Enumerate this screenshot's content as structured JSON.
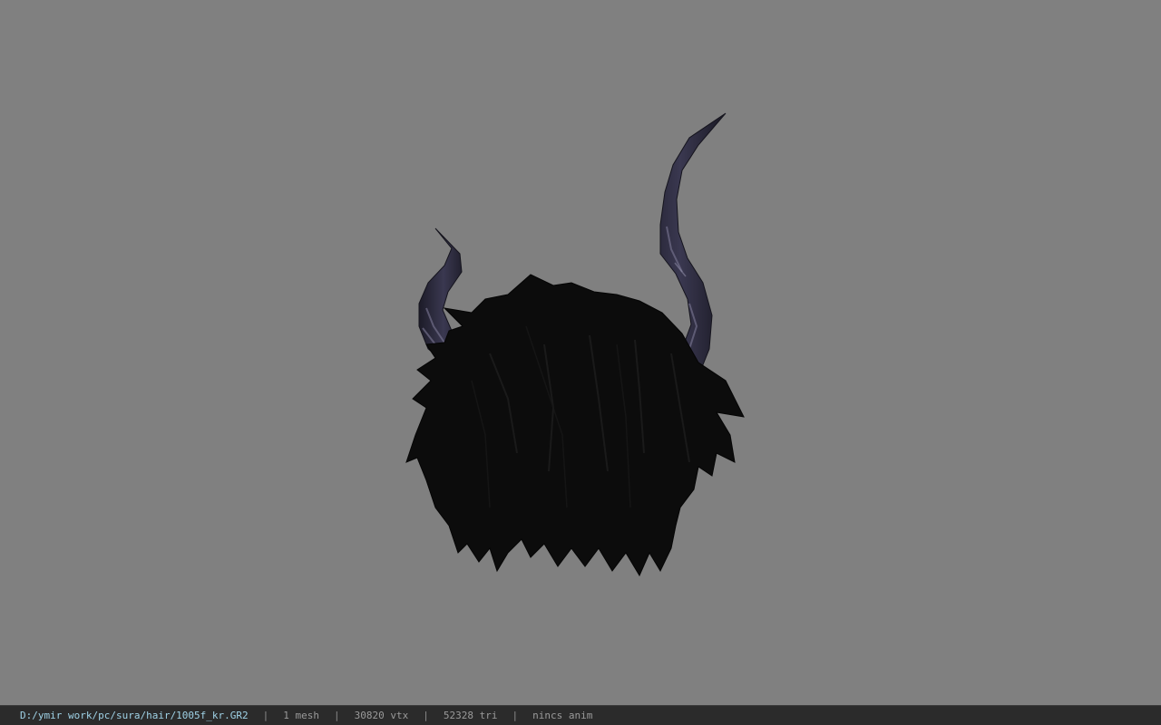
{
  "viewer": {
    "background": "#808080",
    "model": {
      "hair_color": "#0d0d0d",
      "horn_color": "#2c2a3c",
      "horn_highlight_color": "#8a88a4"
    }
  },
  "status_bar": {
    "file_path": "D:/ymir work/pc/sura/hair/1005f_kr.GR2",
    "separator": "|",
    "mesh_count": "1 mesh",
    "vertex_count": "30820 vtx",
    "triangle_count": "52328 tri",
    "anim_status": "nincs anim",
    "path_color": "#9fd2e6"
  }
}
